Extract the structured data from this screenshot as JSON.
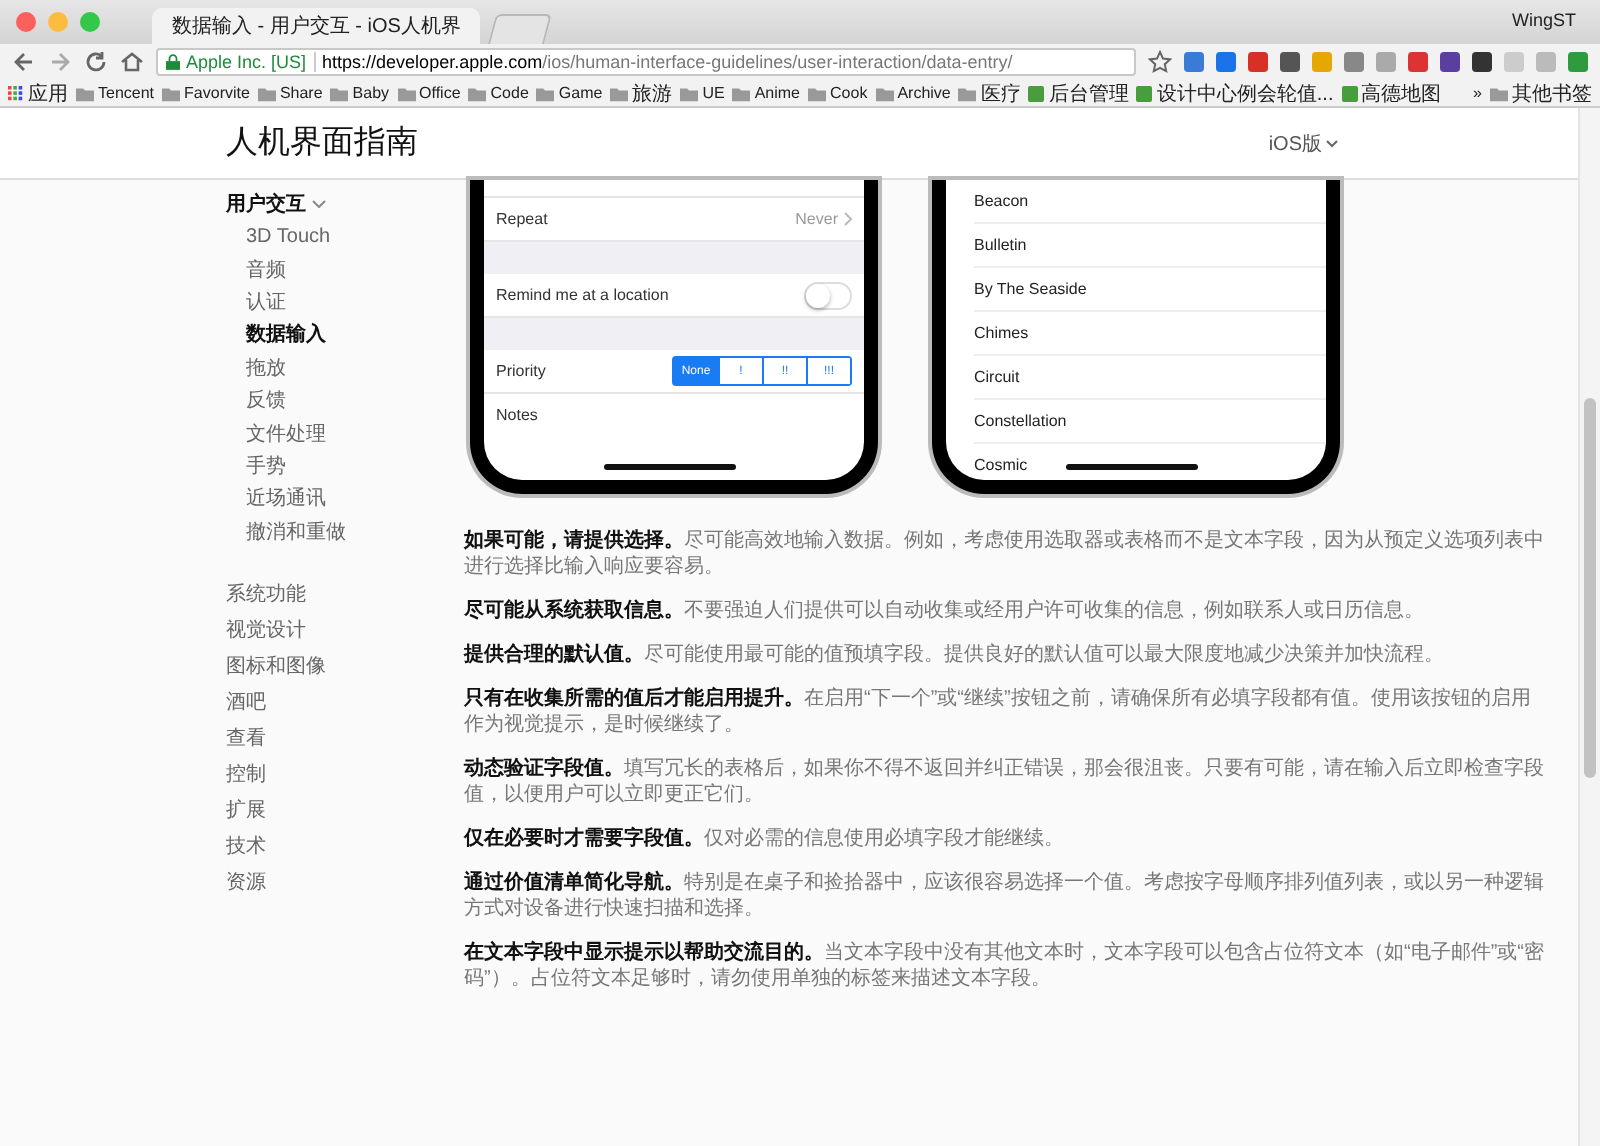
{
  "browser": {
    "tab_title": "数据输入 - 用户交互 - iOS人机界",
    "profile": "WingST",
    "site_identity": "Apple Inc. [US]",
    "url_host": "https://developer.apple.com",
    "url_path": "/ios/human-interface-guidelines/user-interaction/data-entry/"
  },
  "bookmarks": [
    {
      "label": "应用",
      "kind": "apps"
    },
    {
      "label": "Tencent",
      "kind": "folder"
    },
    {
      "label": "Favorvite",
      "kind": "folder"
    },
    {
      "label": "Share",
      "kind": "folder"
    },
    {
      "label": "Baby",
      "kind": "folder"
    },
    {
      "label": "Office",
      "kind": "folder"
    },
    {
      "label": "Code",
      "kind": "folder"
    },
    {
      "label": "Game",
      "kind": "folder"
    },
    {
      "label": "旅游",
      "kind": "folder"
    },
    {
      "label": "UE",
      "kind": "folder"
    },
    {
      "label": "Anime",
      "kind": "folder"
    },
    {
      "label": "Cook",
      "kind": "folder"
    },
    {
      "label": "Archive",
      "kind": "folder"
    },
    {
      "label": "医疗",
      "kind": "folder"
    },
    {
      "label": "后台管理",
      "kind": "site"
    },
    {
      "label": "设计中心例会轮值...",
      "kind": "site"
    },
    {
      "label": "高德地图",
      "kind": "site"
    }
  ],
  "more_bookmarks": {
    "chevron": "»",
    "label": "其他书签"
  },
  "header": {
    "title": "人机界面指南",
    "platform": "iOS版"
  },
  "sidebar": {
    "items": [
      {
        "label": "用户交互",
        "expanded": true,
        "children": [
          {
            "label": "3D Touch",
            "selected": false
          },
          {
            "label": "音频",
            "selected": false
          },
          {
            "label": "认证",
            "selected": false
          },
          {
            "label": "数据输入",
            "selected": true
          },
          {
            "label": "拖放",
            "selected": false
          },
          {
            "label": "反馈",
            "selected": false
          },
          {
            "label": "文件处理",
            "selected": false
          },
          {
            "label": "手势",
            "selected": false
          },
          {
            "label": "近场通讯",
            "selected": false
          },
          {
            "label": "撤消和重做",
            "selected": false
          }
        ]
      },
      {
        "label": "系统功能",
        "expanded": false
      },
      {
        "label": "视觉设计",
        "expanded": false
      },
      {
        "label": "图标和图像",
        "expanded": false
      },
      {
        "label": "酒吧",
        "expanded": false
      },
      {
        "label": "查看",
        "expanded": false
      },
      {
        "label": "控制",
        "expanded": false
      },
      {
        "label": "扩展",
        "expanded": false
      },
      {
        "label": "技术",
        "expanded": false
      },
      {
        "label": "资源",
        "expanded": false
      }
    ]
  },
  "left_phone": {
    "rows": [
      {
        "kind": "disclosure",
        "label": "Repeat",
        "value": "Never"
      },
      {
        "kind": "gap"
      },
      {
        "kind": "toggle",
        "label": "Remind me at a location",
        "on": false
      },
      {
        "kind": "gap"
      },
      {
        "kind": "segmented",
        "label": "Priority",
        "segments": [
          {
            "label": "None",
            "selected": true
          },
          {
            "label": "!",
            "selected": false
          },
          {
            "label": "!!",
            "selected": false
          },
          {
            "label": "!!!",
            "selected": false
          }
        ]
      },
      {
        "kind": "text",
        "label": "Notes"
      }
    ]
  },
  "right_phone": {
    "items": [
      "Beacon",
      "Bulletin",
      "By The Seaside",
      "Chimes",
      "Circuit",
      "Constellation",
      "Cosmic"
    ]
  },
  "paragraphs": [
    "**如果可能，请提供选择。**尽可能高效地输入数据。例如，考虑使用选取器或表格而不是文本字段，因为从预定义选项列表中进行选择比输入响应要容易。",
    "**尽可能从系统获取信息。**不要强迫人们提供可以自动收集或经用户许可收集的信息，例如联系人或日历信息。",
    "**提供合理的默认值。**尽可能使用最可能的值预填字段。提供良好的默认值可以最大限度地减少决策并加快流程。",
    "**只有在收集所需的值后才能启用提升。**在启用“下一个”或“继续”按钮之前，请确保所有必填字段都有值。使用该按钮的启用作为视觉提示，是时候继续了。",
    "**动态验证字段值。**填写冗长的表格后，如果你不得不返回并纠正错误，那会很沮丧。只要有可能，请在输入后立即检查字段值，以便用户可以立即更正它们。",
    "**仅在必要时才需要字段值。**仅对必需的信息使用必填字段才能继续。",
    "**通过价值清单简化导航。**特别是在桌子和捡拾器中，应该很容易选择一个值。考虑按字母顺序排列值列表，或以另一种逻辑方式对设备进行快速扫描和选择。",
    "**在文本字段中显示提示以帮助交流目的。**当文本字段中没有其他文本时，文本字段可以包含占位符文本（如“电子邮件”或“密码”）。占位符文本足够时，请勿使用单独的标签来描述文本字段。"
  ]
}
